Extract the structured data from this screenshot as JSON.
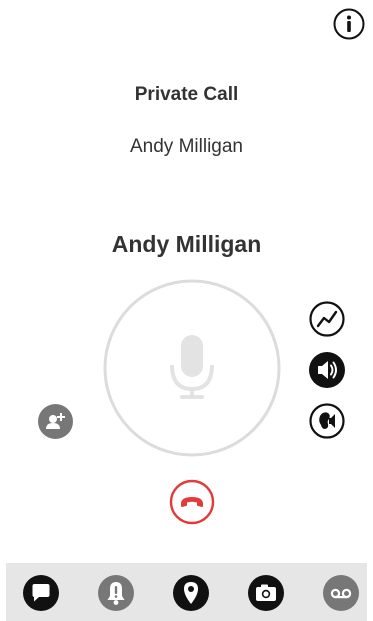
{
  "call": {
    "type_label": "Private Call",
    "callee_name_top": "Andy Milligan",
    "callee_name": "Andy Milligan"
  },
  "icons": {
    "info": "info-icon",
    "ptt": "microphone-icon",
    "signal": "signal-graph-icon",
    "speaker": "speaker-icon",
    "earpiece": "earpiece-icon",
    "add_user": "add-user-icon",
    "end_call": "end-call-icon"
  },
  "bottom_nav": [
    {
      "name": "chat",
      "icon": "chat-bubble-icon"
    },
    {
      "name": "alert",
      "icon": "alert-bell-icon"
    },
    {
      "name": "location",
      "icon": "location-pin-icon"
    },
    {
      "name": "camera",
      "icon": "camera-icon"
    },
    {
      "name": "voicemail",
      "icon": "voicemail-icon"
    }
  ],
  "colors": {
    "end_call": "#e23b3b",
    "icon_dark": "#111111",
    "icon_grey": "#777777",
    "ring": "#dcdcdc",
    "nav_bg": "#e6e6e6"
  }
}
